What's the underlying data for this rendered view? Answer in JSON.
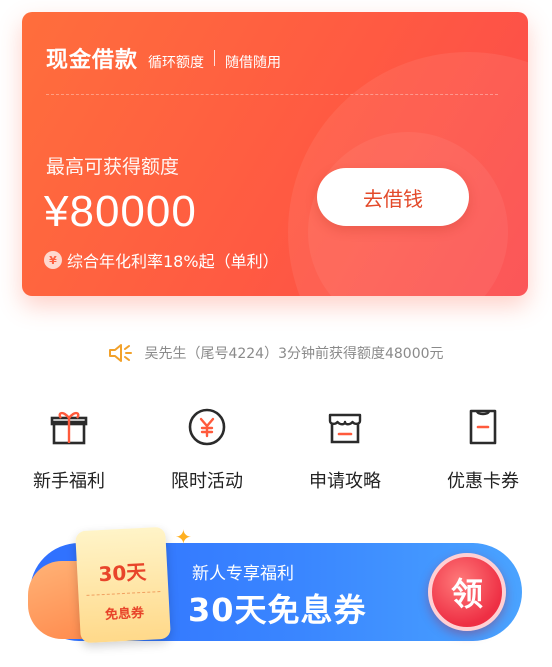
{
  "loan_card": {
    "title": "现金借款",
    "tag1": "循环额度",
    "tag2": "随借随用",
    "subtitle": "最高可获得额度",
    "amount": "¥80000",
    "rate_badge": "¥",
    "rate": "综合年化利率18%起（单利）",
    "borrow_button": "去借钱"
  },
  "notice": {
    "icon": "speaker-icon",
    "text": "吴先生（尾号4224）3分钟前获得额度48000元"
  },
  "menu": [
    {
      "label": "新手福利",
      "icon": "gift-icon"
    },
    {
      "label": "限时活动",
      "icon": "yen-coin-icon"
    },
    {
      "label": "申请攻略",
      "icon": "store-icon"
    },
    {
      "label": "优惠卡券",
      "icon": "coupon-icon"
    }
  ],
  "banner": {
    "ticket_top": "30天",
    "ticket_bottom": "免息券",
    "subtitle": "新人专享福利",
    "title": "30天免息券",
    "claim": "领"
  },
  "colors": {
    "accent": "#ff5a42",
    "banner": "#3a86ff",
    "icon_stroke": "#2b2b2b",
    "icon_accent": "#ff5a3c"
  }
}
